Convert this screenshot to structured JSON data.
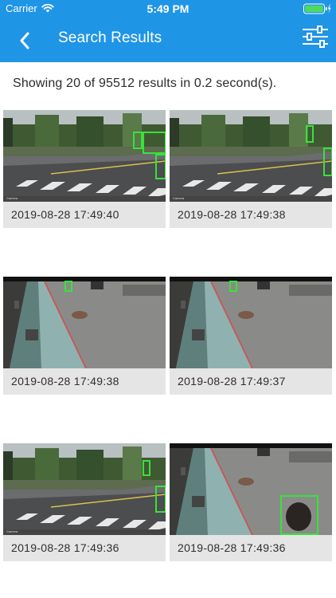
{
  "status_bar": {
    "carrier": "Carrier",
    "time": "5:49 PM",
    "battery_level": 1.0
  },
  "nav": {
    "title": "Search Results",
    "back_icon": "chevron-left-icon",
    "filter_icon": "sliders-icon"
  },
  "summary": "Showing 20 of 95512 results in 0.2 second(s).",
  "results": [
    {
      "timestamp": "2019-08-28 17:49:40",
      "scene": "crosswalk"
    },
    {
      "timestamp": "2019-08-28 17:49:38",
      "scene": "crosswalk"
    },
    {
      "timestamp": "2019-08-28 17:49:38",
      "scene": "sidewalk"
    },
    {
      "timestamp": "2019-08-28 17:49:37",
      "scene": "sidewalk"
    },
    {
      "timestamp": "2019-08-28 17:49:36",
      "scene": "crosswalk"
    },
    {
      "timestamp": "2019-08-28 17:49:36",
      "scene": "sidewalk"
    }
  ],
  "colors": {
    "header": "#1f95e6",
    "detection_box": "#37e33a",
    "card_background": "#e5e5e5"
  }
}
